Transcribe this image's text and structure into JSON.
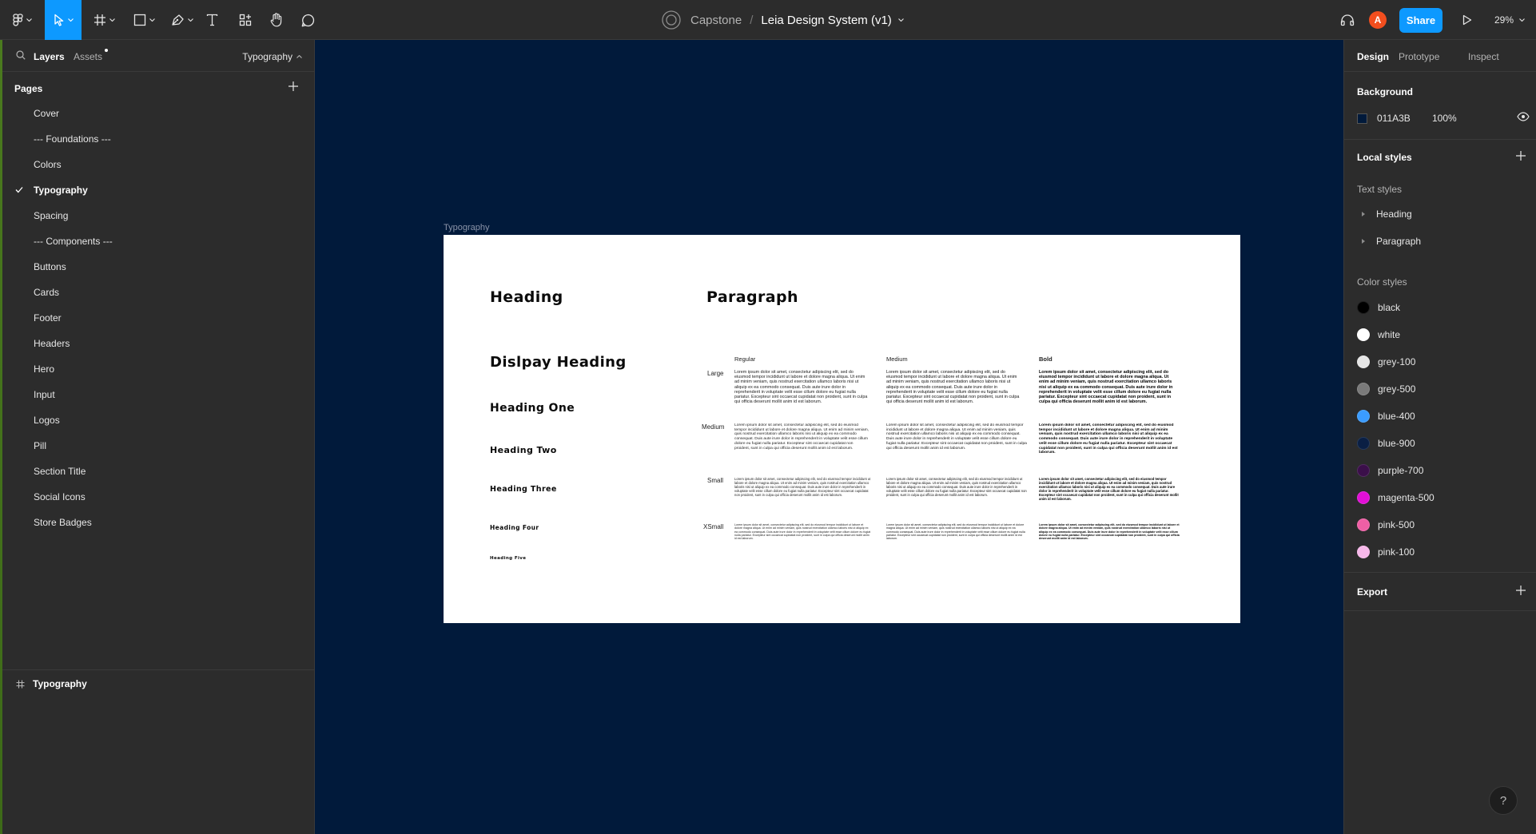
{
  "toolbar": {
    "project": "Capstone",
    "separator": "/",
    "file_name": "Leia Design System (v1)",
    "avatar_initial": "A",
    "share_label": "Share",
    "zoom": "29%"
  },
  "left_panel": {
    "tabs": {
      "layers": "Layers",
      "assets": "Assets"
    },
    "page_selector": "Typography",
    "pages_heading": "Pages",
    "pages": [
      "Cover",
      "--- Foundations ---",
      "Colors",
      "Typography",
      "Spacing",
      "--- Components ---",
      "Buttons",
      "Cards",
      "Footer",
      "Headers",
      "Hero",
      "Input",
      "Logos",
      "Pill",
      "Section Title",
      "Social Icons",
      "Store Badges"
    ],
    "current_page": "Typography",
    "layer": "Typography"
  },
  "canvas": {
    "background": "#011A3B",
    "frame_label": "Typography",
    "heading_col": {
      "title": "Heading",
      "display": "Dislpay Heading",
      "h1": "Heading One",
      "h2": "Heading Two",
      "h3": "Heading Three",
      "h4": "Heading Four",
      "h5": "Heading Five"
    },
    "paragraph_col": {
      "title": "Paragraph",
      "weights": {
        "regular": "Regular",
        "medium": "Medium",
        "bold": "Bold"
      },
      "sizes": {
        "large": "Large",
        "medium": "Medium",
        "small": "Small",
        "xsmall": "XSmall"
      },
      "lorem": "Lorem ipsum dolor sit amet, consectetur adipiscing elit, sed do eiusmod tempor incididunt ut labore et dolore magna aliqua. Ut enim ad minim veniam, quis nostrud exercitation ullamco laboris nisi ut aliquip ex ea commodo consequat. Duis aute irure dolor in reprehenderit in voluptate velit esse cillum dolore eu fugiat nulla pariatur. Excepteur sint occaecat cupidatat non proident, sunt in culpa qui officia deserunt mollit anim id est laborum."
    }
  },
  "right_panel": {
    "tabs": {
      "design": "Design",
      "prototype": "Prototype",
      "inspect": "Inspect"
    },
    "background_heading": "Background",
    "background_hex": "011A3B",
    "background_opacity": "100%",
    "local_styles_heading": "Local styles",
    "text_styles_heading": "Text styles",
    "text_styles": [
      "Heading",
      "Paragraph"
    ],
    "color_styles_heading": "Color styles",
    "color_styles": [
      {
        "name": "black",
        "color": "#000000"
      },
      {
        "name": "white",
        "color": "#ffffff"
      },
      {
        "name": "grey-100",
        "color": "#e6e6e6"
      },
      {
        "name": "grey-500",
        "color": "#7a7a7a"
      },
      {
        "name": "blue-400",
        "color": "#3b9cff"
      },
      {
        "name": "blue-900",
        "color": "#0a1f44"
      },
      {
        "name": "purple-700",
        "color": "#3b0f4a"
      },
      {
        "name": "magenta-500",
        "color": "#e10fd6"
      },
      {
        "name": "pink-500",
        "color": "#ef5fa5"
      },
      {
        "name": "pink-100",
        "color": "#f7b8ea"
      }
    ],
    "export_heading": "Export"
  },
  "help_label": "?"
}
